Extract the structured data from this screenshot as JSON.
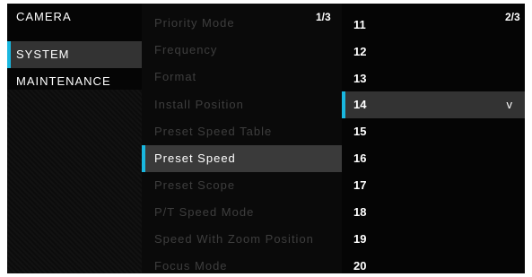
{
  "categories": [
    {
      "label": "CAMERA"
    },
    {
      "label": "SYSTEM"
    },
    {
      "label": "MAINTENANCE"
    }
  ],
  "system_menu": {
    "page_indicator": "1/3",
    "items": [
      {
        "label": "Priority Mode"
      },
      {
        "label": "Frequency"
      },
      {
        "label": "Format"
      },
      {
        "label": "Install Position"
      },
      {
        "label": "Preset Speed Table"
      },
      {
        "label": "Preset Speed"
      },
      {
        "label": "Preset Scope"
      },
      {
        "label": "P/T Speed Mode"
      },
      {
        "label": "Speed With Zoom Position"
      },
      {
        "label": "Focus Mode"
      }
    ]
  },
  "value_list": {
    "page_indicator": "2/3",
    "items": [
      {
        "label": "11"
      },
      {
        "label": "12"
      },
      {
        "label": "13"
      },
      {
        "label": "14",
        "check": "v"
      },
      {
        "label": "15"
      },
      {
        "label": "16"
      },
      {
        "label": "17"
      },
      {
        "label": "18"
      },
      {
        "label": "19"
      },
      {
        "label": "20"
      }
    ]
  },
  "colors": {
    "accent": "#19b7df",
    "background": "#050505",
    "selected_bg": "#333333",
    "text": "#ffffff",
    "dim_text": "#3e3e3e"
  }
}
